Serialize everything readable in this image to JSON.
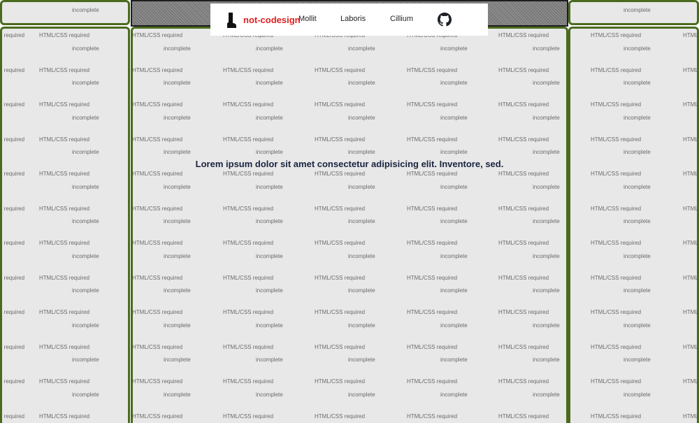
{
  "placeholder": {
    "required_text": "HTML/CSS required",
    "status_text": "incomplete"
  },
  "nav": {
    "brand": "not-codesign",
    "links": [
      "Mollit",
      "Laboris",
      "Cillium"
    ],
    "github_icon": "github-icon",
    "brand_icon": "boot-icon"
  },
  "hero": {
    "text": "Lorem ipsum dolor sit amet consectetur adipisicing elit. Inventore, sed."
  },
  "colors": {
    "placeholder_bg": "#e8e8e8",
    "placeholder_border": "#4a6b1e",
    "brand": "#e02020",
    "hero_text": "#1a2340"
  }
}
